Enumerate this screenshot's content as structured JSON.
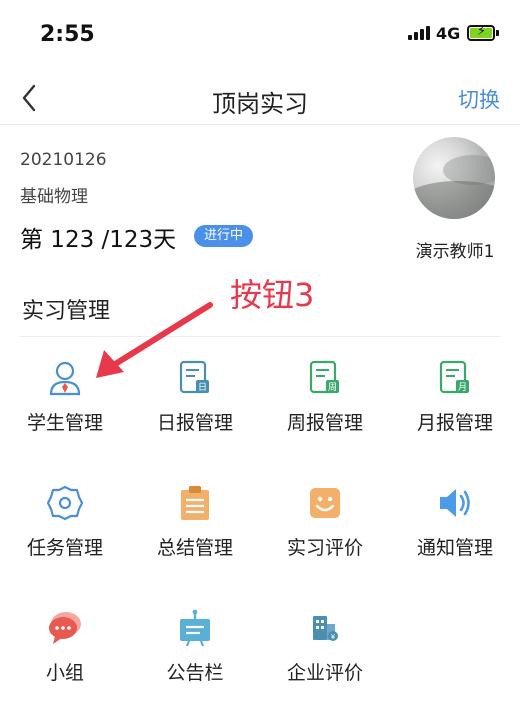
{
  "status_bar": {
    "time": "2:55",
    "network": "4G"
  },
  "nav": {
    "title": "顶岗实习",
    "action": "切换"
  },
  "profile": {
    "id": "20210126",
    "course": "基础物理",
    "days": "第 123 /123天",
    "status": "进行中",
    "teacher": "演示教师1"
  },
  "section": {
    "title": "实习管理"
  },
  "annotation": {
    "text": "按钮3"
  },
  "menu": [
    {
      "label": "学生管理",
      "icon": "student-icon",
      "color": "#4a8fd6"
    },
    {
      "label": "日报管理",
      "icon": "daily-report-icon",
      "color": "#4a8fb0"
    },
    {
      "label": "周报管理",
      "icon": "weekly-report-icon",
      "color": "#3aa86b"
    },
    {
      "label": "月报管理",
      "icon": "monthly-report-icon",
      "color": "#3aa86b"
    },
    {
      "label": "任务管理",
      "icon": "task-gear-icon",
      "color": "#4a8fd6"
    },
    {
      "label": "总结管理",
      "icon": "summary-clipboard-icon",
      "color": "#e09a3a"
    },
    {
      "label": "实习评价",
      "icon": "smiley-evaluation-icon",
      "color": "#e09a3a"
    },
    {
      "label": "通知管理",
      "icon": "speaker-icon",
      "color": "#4a8fd6"
    },
    {
      "label": "小组",
      "icon": "group-chat-icon",
      "color": "#e85a4f"
    },
    {
      "label": "公告栏",
      "icon": "bulletin-board-icon",
      "color": "#4aa0c8"
    },
    {
      "label": "企业评价",
      "icon": "company-building-icon",
      "color": "#4a8fb0"
    }
  ]
}
